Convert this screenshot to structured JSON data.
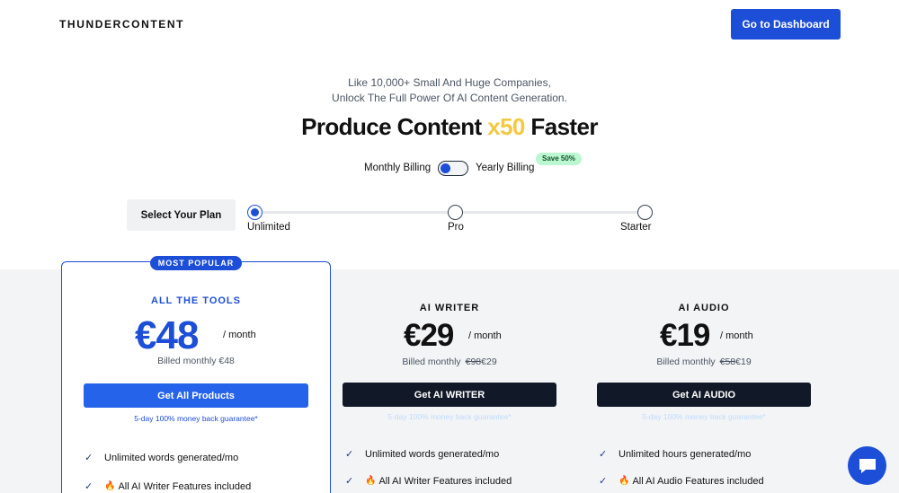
{
  "header": {
    "logo": "THUNDERCONTENT",
    "dashboard_label": "Go to Dashboard"
  },
  "hero": {
    "line1": "Like 10,000+ Small And Huge Companies,",
    "line2": "Unlock The Full Power Of AI Content Generation.",
    "headline_pre": "Produce Content",
    "headline_accent": "x50",
    "headline_post": "Faster",
    "accent_color": "#f5c842"
  },
  "billing": {
    "monthly_label": "Monthly Billing",
    "yearly_label": "Yearly Billing",
    "save_badge": "Save 50%",
    "selected": "monthly"
  },
  "plan_selector": {
    "label": "Select Your Plan",
    "options": [
      "Unlimited",
      "Pro",
      "Starter"
    ],
    "selected": "Unlimited"
  },
  "plans": [
    {
      "badge": "MOST POPULAR",
      "title": "ALL THE TOOLS",
      "price": "€48",
      "per": "/ month",
      "billed_prefix": "Billed monthly",
      "billed_old": "",
      "billed_new": "€48",
      "cta": "Get All Products",
      "guarantee": "5-day 100% money back guarantee*",
      "features": [
        {
          "text": "Unlimited words generated/mo",
          "fire": false
        },
        {
          "text": "All AI Writer Features included",
          "fire": true
        }
      ]
    },
    {
      "title": "AI WRITER",
      "price": "€29",
      "per": "/ month",
      "billed_prefix": "Billed monthly",
      "billed_old": "€98",
      "billed_new": "€29",
      "cta": "Get AI WRITER",
      "guarantee": "5-day 100% money back guarantee*",
      "features": [
        {
          "text": "Unlimited words generated/mo",
          "fire": false
        },
        {
          "text": "All AI Writer Features included",
          "fire": true
        }
      ]
    },
    {
      "title": "AI AUDIO",
      "price": "€19",
      "per": "/ month",
      "billed_prefix": "Billed monthly",
      "billed_old": "€58",
      "billed_new": "€19",
      "cta": "Get AI AUDIO",
      "guarantee": "5-day 100% money back guarantee*",
      "features": [
        {
          "text": "Unlimited hours generated/mo",
          "fire": false
        },
        {
          "text": "All AI Audio Features included",
          "fire": true
        }
      ]
    }
  ],
  "icons": {
    "check": "check-icon",
    "fire": "fire-icon",
    "chat": "chat-icon"
  },
  "colors": {
    "brand_blue": "#1d4ed8",
    "dark_button": "#111827",
    "save_badge_bg": "#bbf7d0"
  }
}
